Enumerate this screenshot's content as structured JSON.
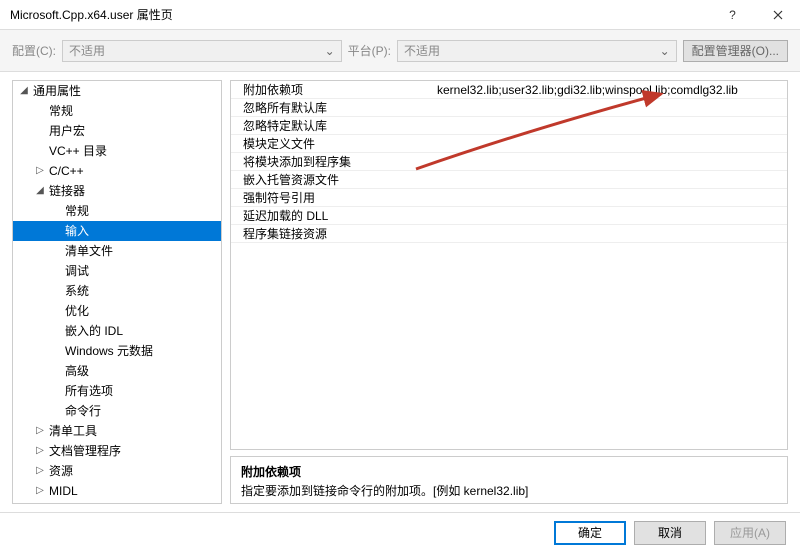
{
  "titlebar": {
    "title": "Microsoft.Cpp.x64.user 属性页"
  },
  "toolbar": {
    "config_label": "配置(C):",
    "config_value": "不适用",
    "platform_label": "平台(P):",
    "platform_value": "不适用",
    "config_mgr": "配置管理器(O)..."
  },
  "tree": {
    "root": "通用属性",
    "items": [
      "常规",
      "用户宏",
      "VC++ 目录"
    ],
    "cpp": "C/C++",
    "linker": "链接器",
    "linker_items": [
      "常规",
      "输入",
      "清单文件",
      "调试",
      "系统",
      "优化",
      "嵌入的 IDL",
      "Windows 元数据",
      "高级",
      "所有选项",
      "命令行"
    ],
    "rest": [
      "清单工具",
      "文档管理程序",
      "资源",
      "MIDL"
    ]
  },
  "grid": {
    "rows": [
      {
        "k": "附加依赖项",
        "v": "kernel32.lib;user32.lib;gdi32.lib;winspool.lib;comdlg32.lib"
      },
      {
        "k": "忽略所有默认库",
        "v": ""
      },
      {
        "k": "忽略特定默认库",
        "v": ""
      },
      {
        "k": "模块定义文件",
        "v": ""
      },
      {
        "k": "将模块添加到程序集",
        "v": ""
      },
      {
        "k": "嵌入托管资源文件",
        "v": ""
      },
      {
        "k": "强制符号引用",
        "v": ""
      },
      {
        "k": "延迟加载的 DLL",
        "v": ""
      },
      {
        "k": "程序集链接资源",
        "v": ""
      }
    ]
  },
  "desc": {
    "title": "附加依赖项",
    "text": "指定要添加到链接命令行的附加项。[例如 kernel32.lib]"
  },
  "footer": {
    "ok": "确定",
    "cancel": "取消",
    "apply": "应用(A)"
  },
  "selected_linker_item": "输入"
}
